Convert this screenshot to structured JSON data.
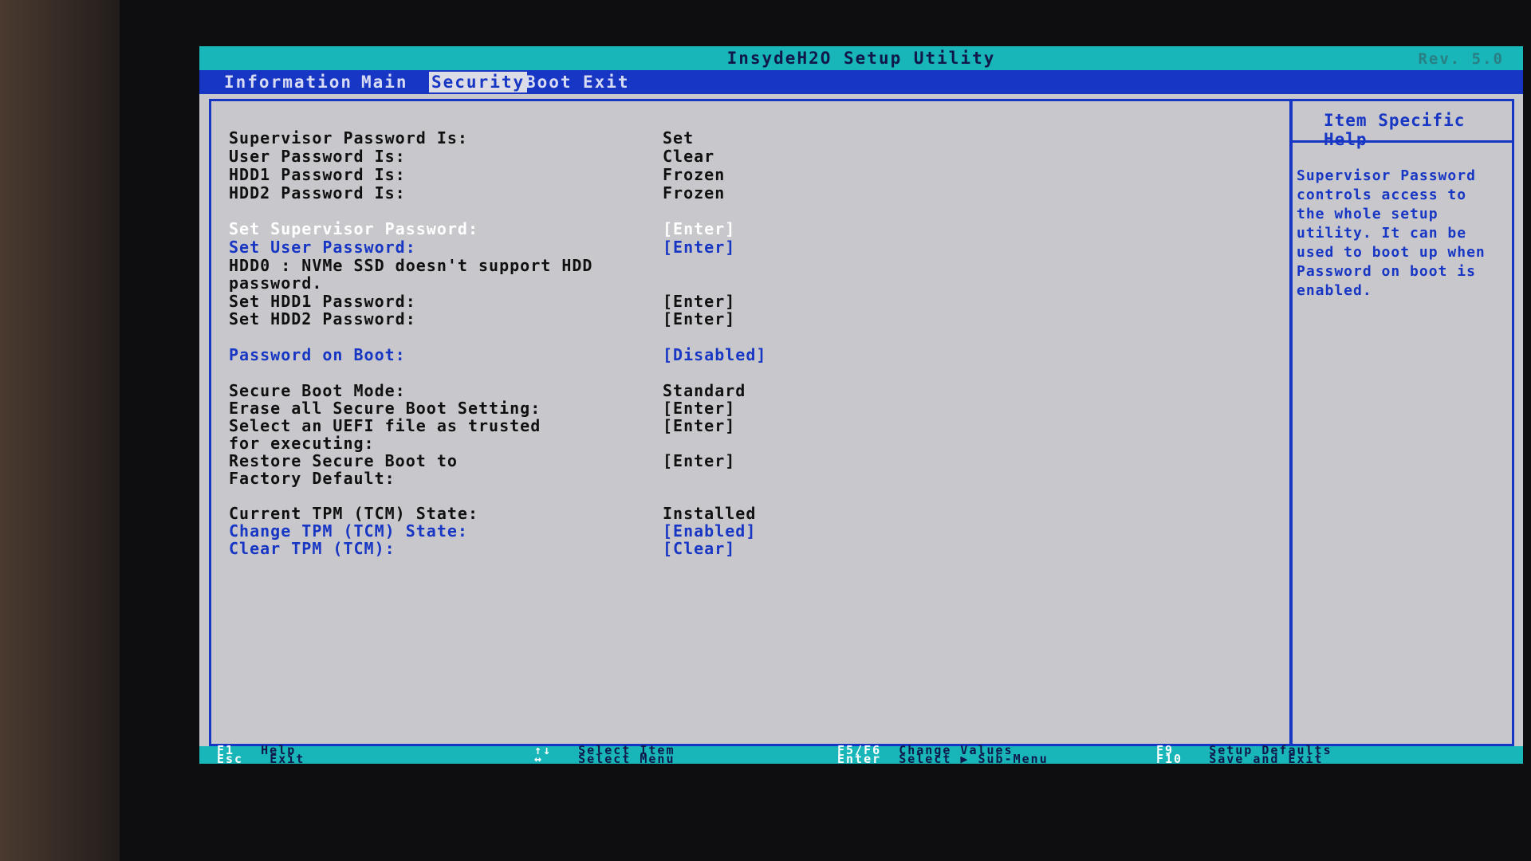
{
  "window": {
    "title": "InsydeH2O Setup Utility",
    "revision": "Rev. 5.0"
  },
  "tabs": [
    "Information",
    "Main",
    "Security",
    "Boot",
    "Exit"
  ],
  "active_tab": "Security",
  "settings": {
    "supervisor_password_is": {
      "label": "Supervisor Password Is:",
      "value": "Set"
    },
    "user_password_is": {
      "label": "User Password Is:",
      "value": "Clear"
    },
    "hdd1_password_is": {
      "label": "HDD1 Password Is:",
      "value": "Frozen"
    },
    "hdd2_password_is": {
      "label": "HDD2 Password Is:",
      "value": "Frozen"
    },
    "set_supervisor_password": {
      "label": "Set Supervisor Password:",
      "value": "[Enter]"
    },
    "set_user_password": {
      "label": "Set User Password:",
      "value": "[Enter]"
    },
    "hdd0_note_line1": "HDD0 : NVMe SSD doesn't support HDD",
    "hdd0_note_line2": "password.",
    "set_hdd1_password": {
      "label": "Set HDD1 Password:",
      "value": "[Enter]"
    },
    "set_hdd2_password": {
      "label": "Set HDD2 Password:",
      "value": "[Enter]"
    },
    "password_on_boot": {
      "label": "Password on Boot:",
      "value": "[Disabled]"
    },
    "secure_boot_mode": {
      "label": "Secure Boot Mode:",
      "value": "Standard"
    },
    "erase_secure_boot": {
      "label": "Erase all Secure Boot Setting:",
      "value": "[Enter]"
    },
    "select_uefi_line1": "Select an UEFI file as trusted",
    "select_uefi_line2": "for executing:",
    "select_uefi_value": "[Enter]",
    "restore_secure_boot_line1": "Restore Secure Boot to",
    "restore_secure_boot_line2": "Factory Default:",
    "restore_secure_boot_value": "[Enter]",
    "current_tpm_state": {
      "label": "Current TPM (TCM) State:",
      "value": "Installed"
    },
    "change_tpm_state": {
      "label": "Change TPM (TCM) State:",
      "value": "[Enabled]"
    },
    "clear_tpm": {
      "label": "Clear TPM (TCM):",
      "value": "[Clear]"
    }
  },
  "help": {
    "title": "Item Specific Help",
    "text": "Supervisor Password controls access to the whole setup utility. It can be used to boot up when Password on boot is enabled."
  },
  "footer": {
    "f1_key": "F1",
    "f1_desc": "Help",
    "esc_key": "Esc",
    "esc_desc": "Exit",
    "updown_key": "↑↓",
    "updown_desc": "Select Item",
    "leftright_key": "↔",
    "leftright_desc": "Select Menu",
    "f5f6_key": "F5/F6",
    "f5f6_desc": "Change Values",
    "enter_key": "Enter",
    "enter_desc": "Select ▶ Sub-Menu",
    "f9_key": "F9",
    "f9_desc": "Setup Defaults",
    "f10_key": "F10",
    "f10_desc": "Save and Exit"
  },
  "colors": {
    "title_bar": "#18b6b8",
    "menu_bar": "#1836c4",
    "screen_background": "#c8c8cc",
    "highlight_text": "#ffffff",
    "selectable_text": "#1836c4"
  }
}
